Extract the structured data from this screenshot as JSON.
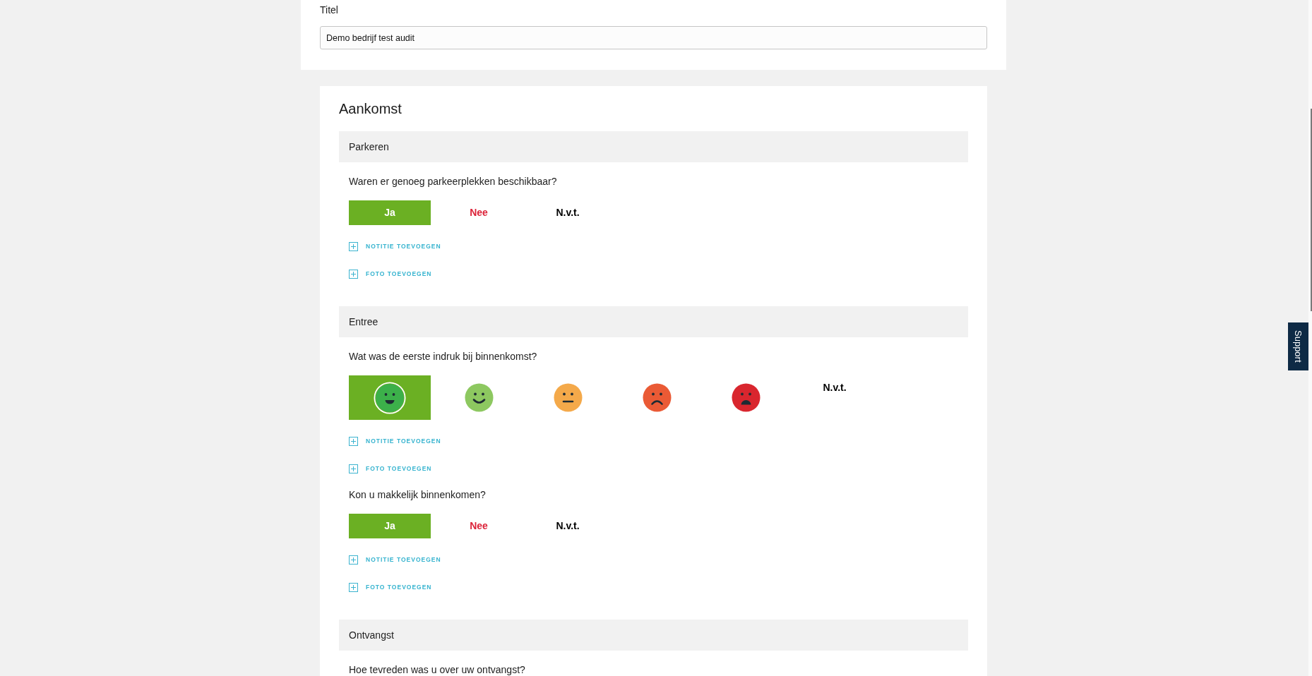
{
  "title_field": {
    "label": "Titel",
    "value": "Demo bedrijf test audit"
  },
  "chapter": {
    "title": "Aankomst",
    "sections": [
      {
        "title": "Parkeren",
        "questions": [
          {
            "text": "Waren er genoeg parkeerplekken beschikbaar?",
            "options": [
              {
                "kind": "label",
                "label": "Ja",
                "color": "#6bb023",
                "selected": true
              },
              {
                "kind": "label",
                "label": "Nee",
                "color": "#dc2339",
                "selected": false
              },
              {
                "kind": "label",
                "label": "N.v.t.",
                "color": "#000000",
                "selected": false
              }
            ],
            "actions": [
              "NOTITIE TOEVOEGEN",
              "FOTO TOEVOEGEN"
            ]
          }
        ]
      },
      {
        "title": "Entree",
        "questions": [
          {
            "text": "Wat was de eerste indruk bij binnenkomst?",
            "options": [
              {
                "kind": "grin",
                "color": "#3cb04a",
                "selected": true
              },
              {
                "kind": "smile",
                "color": "#8dc860",
                "selected": false
              },
              {
                "kind": "neutral",
                "color": "#f4a94a",
                "selected": false
              },
              {
                "kind": "frown",
                "color": "#ea5a35",
                "selected": false
              },
              {
                "kind": "upset",
                "color": "#d9262e",
                "selected": false
              },
              {
                "kind": "label",
                "label": "N.v.t.",
                "color": "#000000",
                "selected": false
              }
            ],
            "actions": [
              "NOTITIE TOEVOEGEN",
              "FOTO TOEVOEGEN"
            ]
          },
          {
            "text": "Kon u makkelijk binnenkomen?",
            "options": [
              {
                "kind": "label",
                "label": "Ja",
                "color": "#6bb023",
                "selected": true
              },
              {
                "kind": "label",
                "label": "Nee",
                "color": "#dc2339",
                "selected": false
              },
              {
                "kind": "label",
                "label": "N.v.t.",
                "color": "#000000",
                "selected": false
              }
            ],
            "actions": [
              "NOTITIE TOEVOEGEN",
              "FOTO TOEVOEGEN"
            ]
          }
        ]
      },
      {
        "title": "Ontvangst",
        "questions": [
          {
            "text": "Hoe tevreden was u over uw ontvangst?"
          }
        ]
      }
    ]
  },
  "support_tab": {
    "label": "Support"
  }
}
